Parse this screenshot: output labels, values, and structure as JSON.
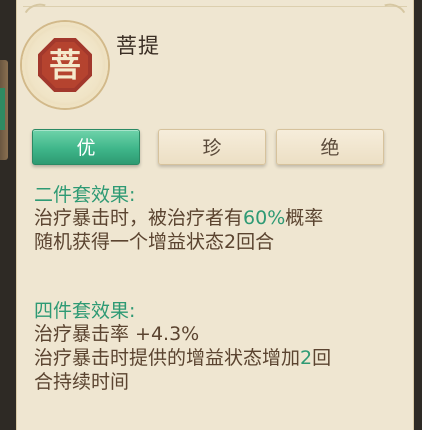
{
  "item": {
    "emblem_char": "菩",
    "title": "菩提"
  },
  "tabs": [
    {
      "label": "优",
      "active": true
    },
    {
      "label": "珍",
      "active": false
    },
    {
      "label": "绝",
      "active": false
    }
  ],
  "two_piece": {
    "heading": "二件套效果:",
    "line1_pre": "治疗暴击时，被治疗者有",
    "line1_value": "60%",
    "line1_post": "概率",
    "line2": "随机获得一个增益状态2回合"
  },
  "four_piece": {
    "heading": "四件套效果:",
    "line1": "治疗暴击率 +4.3%",
    "line2_pre": "治疗暴击时提供的增益状态增加",
    "line2_value": "2",
    "line2_post": "回",
    "line3": "合持续时间"
  },
  "colors": {
    "accent_green": "#2e9a74",
    "brown_text": "#5b4430",
    "emblem_red": "#a2382c"
  }
}
